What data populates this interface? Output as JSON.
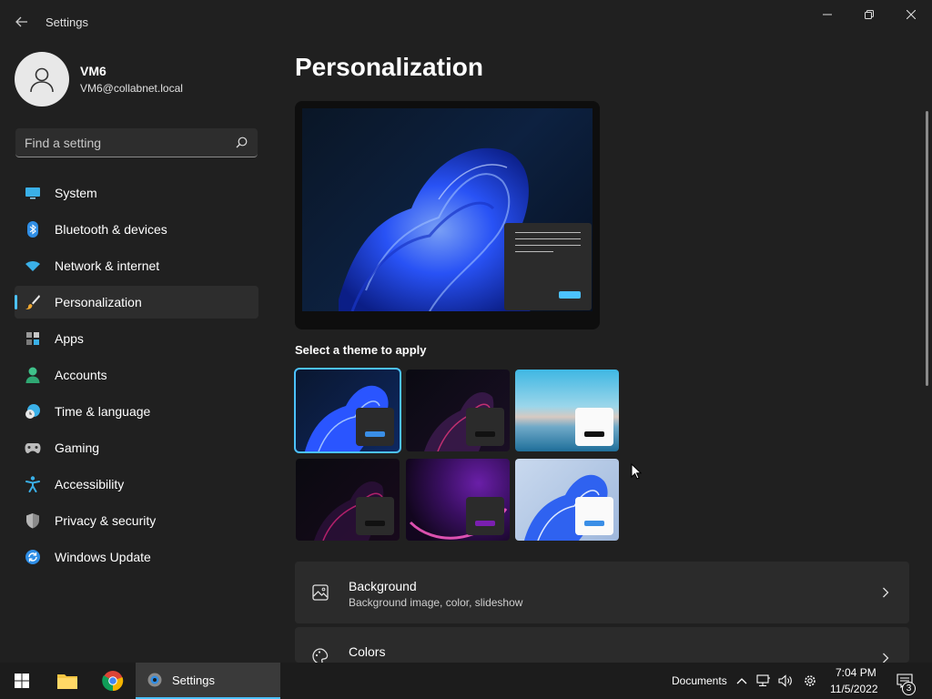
{
  "window": {
    "title": "Settings"
  },
  "profile": {
    "name": "VM6",
    "email": "VM6@collabnet.local"
  },
  "search": {
    "placeholder": "Find a setting"
  },
  "nav": {
    "items": [
      {
        "label": "System",
        "icon": "monitor-icon"
      },
      {
        "label": "Bluetooth & devices",
        "icon": "bluetooth-icon"
      },
      {
        "label": "Network & internet",
        "icon": "wifi-icon"
      },
      {
        "label": "Personalization",
        "icon": "brush-icon",
        "active": true
      },
      {
        "label": "Apps",
        "icon": "apps-icon"
      },
      {
        "label": "Accounts",
        "icon": "person-icon"
      },
      {
        "label": "Time & language",
        "icon": "clock-globe-icon"
      },
      {
        "label": "Gaming",
        "icon": "gamepad-icon"
      },
      {
        "label": "Accessibility",
        "icon": "accessibility-icon"
      },
      {
        "label": "Privacy & security",
        "icon": "shield-icon"
      },
      {
        "label": "Windows Update",
        "icon": "update-icon"
      }
    ]
  },
  "main": {
    "title": "Personalization",
    "themes_caption": "Select a theme to apply",
    "themes": [
      {
        "name": "windows-dark-bloom",
        "selected": true
      },
      {
        "name": "glow-dark"
      },
      {
        "name": "captured-motion"
      },
      {
        "name": "sunrise"
      },
      {
        "name": "flow"
      },
      {
        "name": "windows-light-bloom"
      }
    ],
    "cards": [
      {
        "title": "Background",
        "subtitle": "Background image, color, slideshow",
        "icon": "image-icon"
      },
      {
        "title": "Colors",
        "subtitle": "",
        "icon": "palette-icon"
      }
    ]
  },
  "taskbar": {
    "active_app": "Settings",
    "toolbar_label": "Documents",
    "time": "7:04 PM",
    "date": "11/5/2022",
    "notification_count": "3"
  },
  "colors": {
    "accent": "#4cc2ff",
    "background": "#202020",
    "card": "#2b2b2b",
    "taskbar": "#1c1c1c"
  }
}
